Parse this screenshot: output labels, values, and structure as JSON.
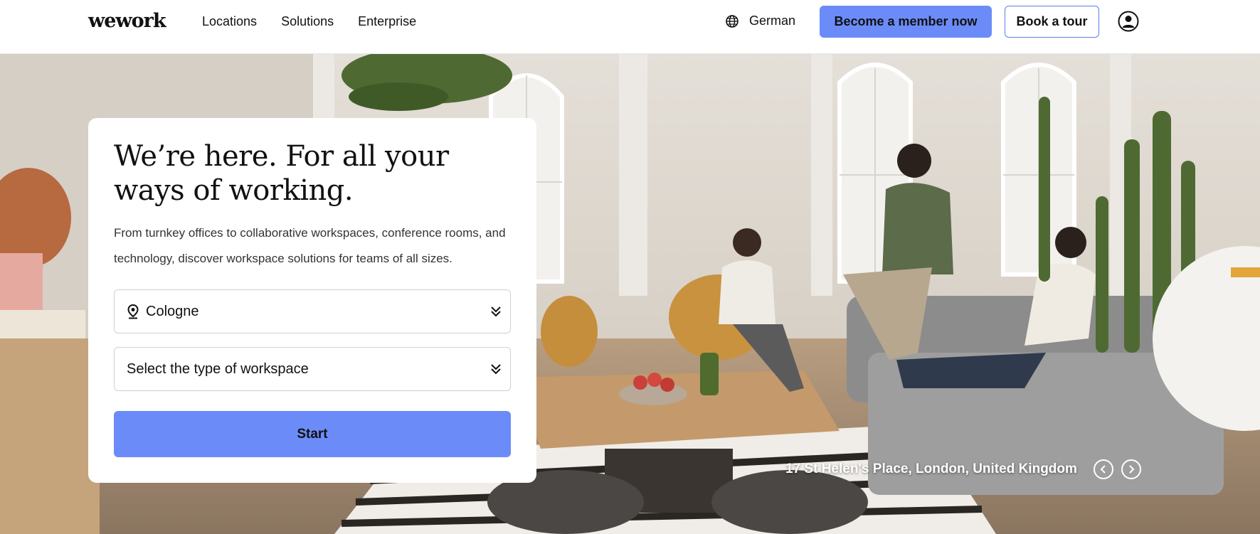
{
  "header": {
    "logo": "wework",
    "nav": [
      "Locations",
      "Solutions",
      "Enterprise"
    ],
    "language": "German",
    "member_button": "Become a member now",
    "tour_button": "Book a tour"
  },
  "hero": {
    "title": "We’re here. For all your ways of working.",
    "description": "From turnkey offices to collaborative workspaces, conference rooms, and technology, discover workspace solutions for teams of all sizes.",
    "location_value": "Cologne",
    "workspace_placeholder": "Select the type of workspace",
    "start_button": "Start",
    "caption": "17 St Helen's Place, London, United Kingdom"
  },
  "colors": {
    "accent": "#6b8cf8",
    "text": "#111111"
  },
  "icons": [
    "globe-icon",
    "user-icon",
    "location-pin-icon",
    "chevron-down-icon",
    "chevron-left-icon",
    "chevron-right-icon"
  ]
}
